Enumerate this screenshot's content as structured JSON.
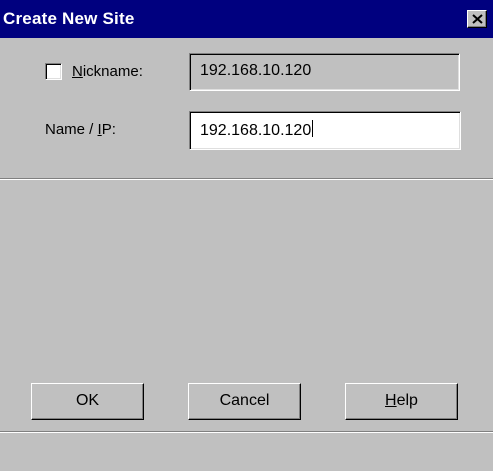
{
  "window": {
    "title": "Create New Site",
    "close_icon": "close-icon"
  },
  "form": {
    "nickname": {
      "label_pre": "",
      "label_accel": "N",
      "label_post": "ickname:",
      "checked": false,
      "value": "192.168.10.120"
    },
    "name_ip": {
      "label_pre": "Name / ",
      "label_accel": "I",
      "label_post": "P:",
      "value": "192.168.10.120"
    }
  },
  "buttons": {
    "ok_label": "OK",
    "cancel_label": "Cancel",
    "help_pre": "",
    "help_accel": "H",
    "help_post": "elp"
  },
  "colors": {
    "titlebar": "#00007f",
    "face": "#c0c0c0"
  }
}
